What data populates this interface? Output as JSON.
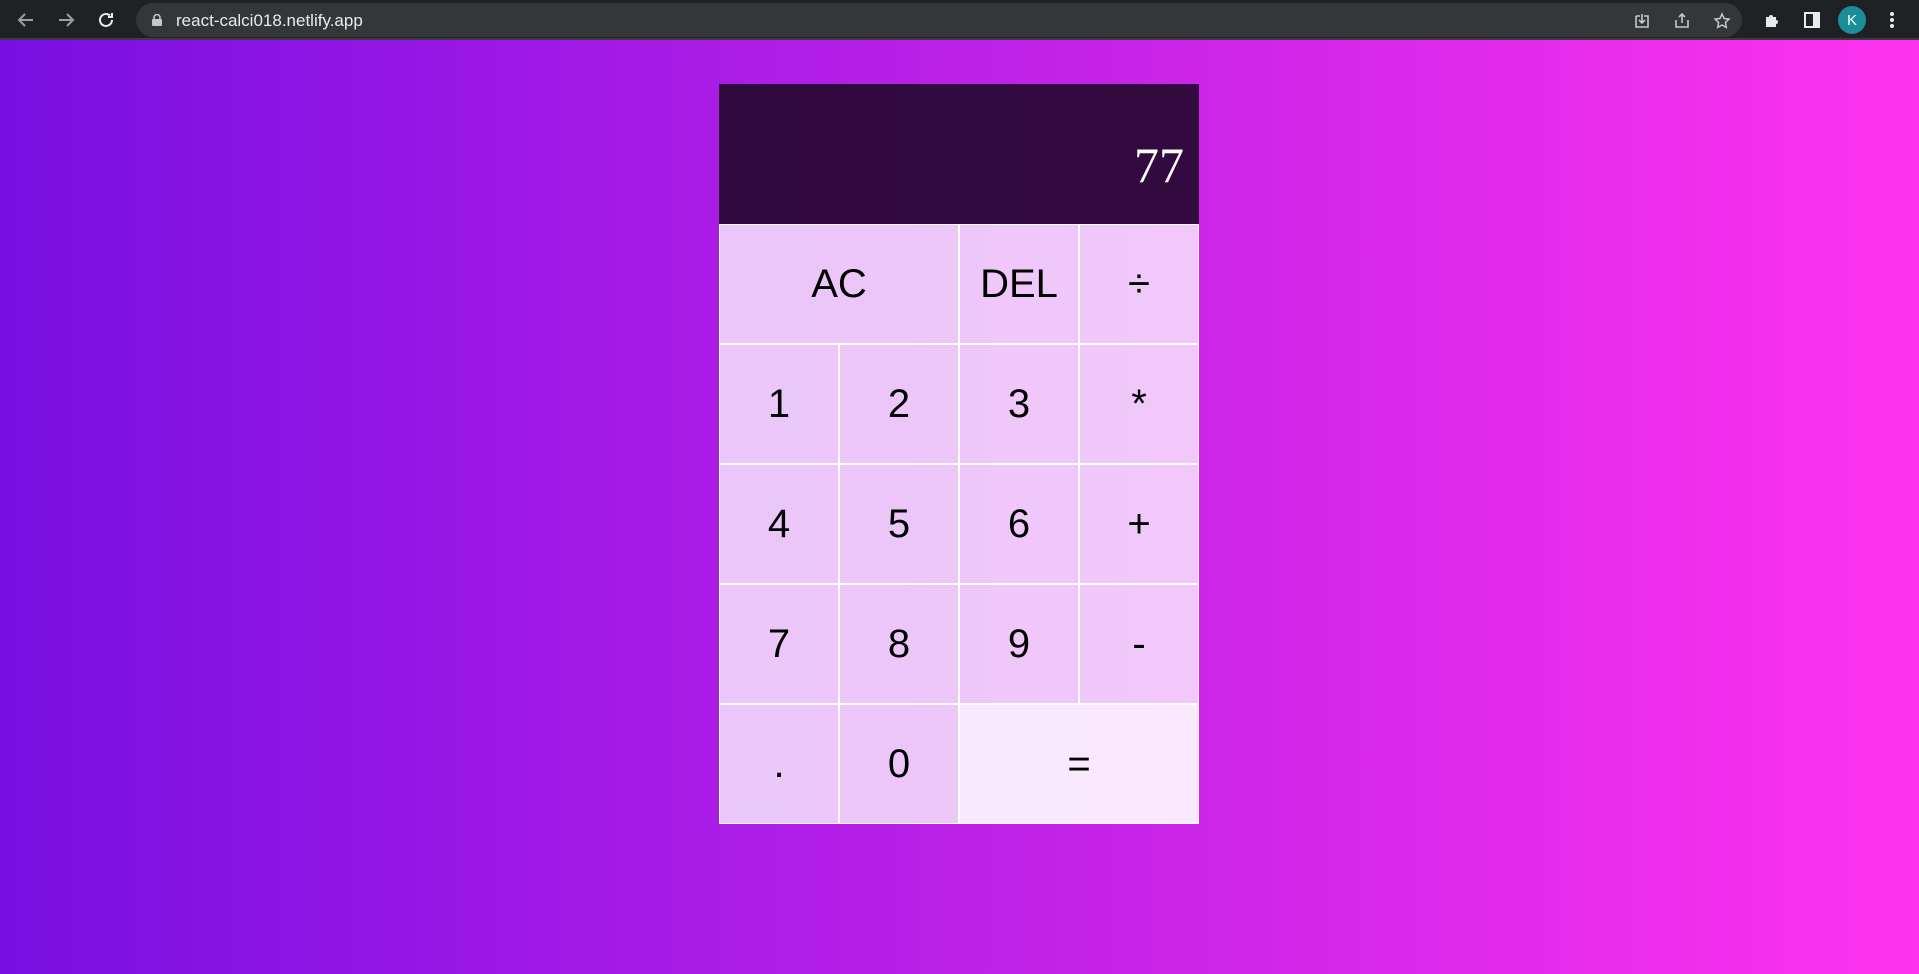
{
  "browser": {
    "url": "react-calci018.netlify.app",
    "avatar_letter": "K"
  },
  "calculator": {
    "display_value": "77",
    "keys": {
      "ac": "AC",
      "del": "DEL",
      "divide": "÷",
      "one": "1",
      "two": "2",
      "three": "3",
      "multiply": "*",
      "four": "4",
      "five": "5",
      "six": "6",
      "plus": "+",
      "seven": "7",
      "eight": "8",
      "nine": "9",
      "minus": "-",
      "dot": ".",
      "zero": "0",
      "equals": "="
    }
  },
  "colors": {
    "gradient_start": "#780fe2",
    "gradient_end": "#ff32ee",
    "display_bg": "#2d0a3a",
    "key_bg": "#eecaf7"
  }
}
